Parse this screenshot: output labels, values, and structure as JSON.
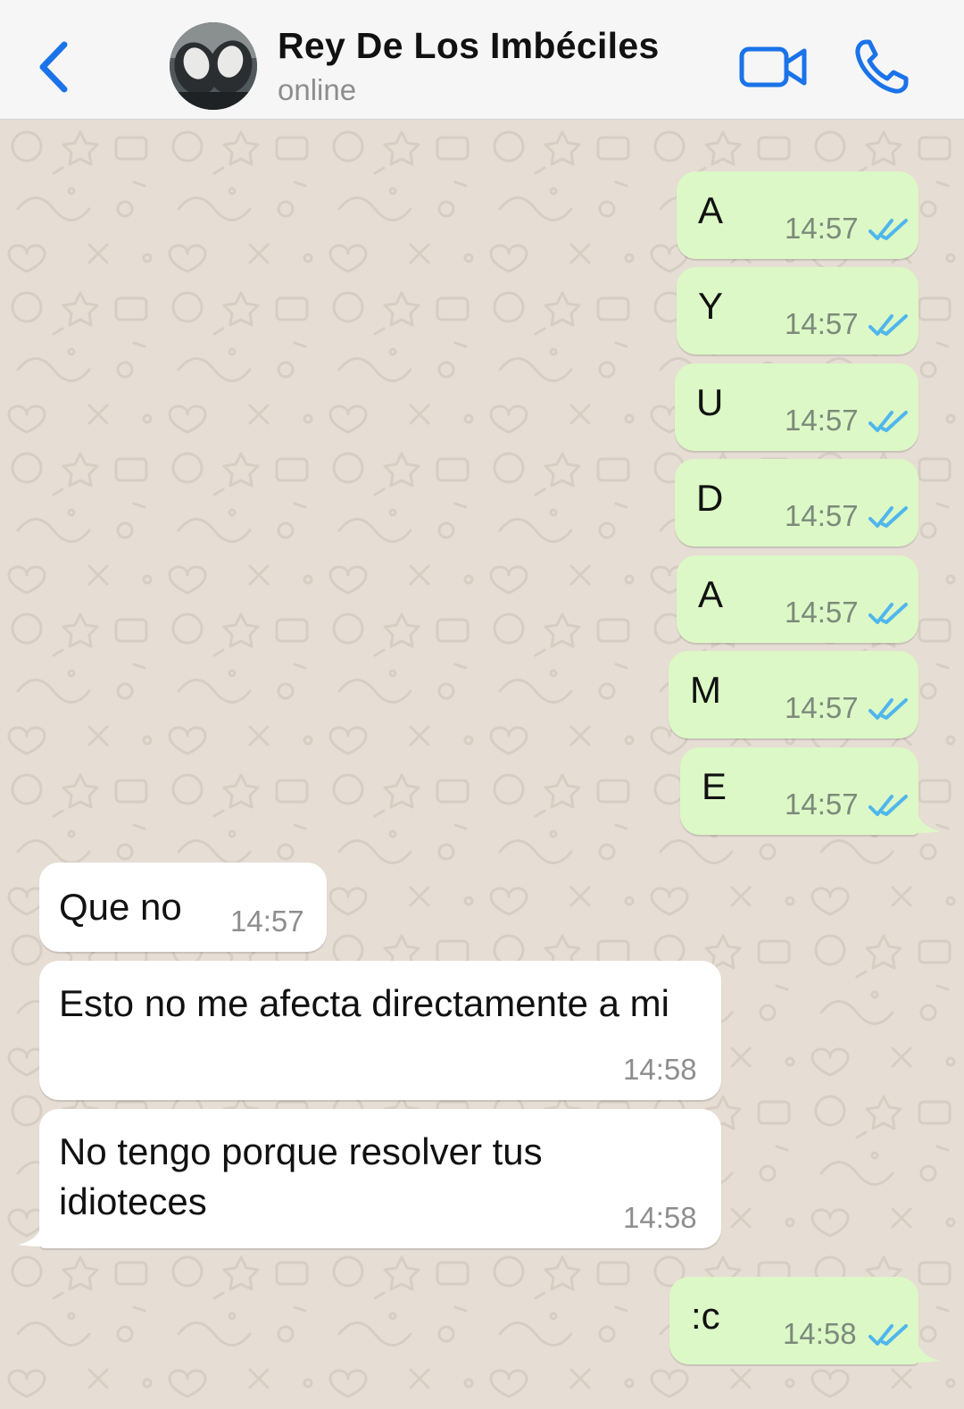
{
  "header": {
    "contact_name": "Rey De Los Imbéciles",
    "status": "online",
    "back_icon": "chevron-left-icon",
    "video_icon": "video-camera-icon",
    "call_icon": "phone-icon",
    "accent_color": "#1a73e8"
  },
  "messages": [
    {
      "direction": "out",
      "text": "A",
      "time": "14:57",
      "read": true
    },
    {
      "direction": "out",
      "text": "Y",
      "time": "14:57",
      "read": true
    },
    {
      "direction": "out",
      "text": "U",
      "time": "14:57",
      "read": true
    },
    {
      "direction": "out",
      "text": "D",
      "time": "14:57",
      "read": true
    },
    {
      "direction": "out",
      "text": "A",
      "time": "14:57",
      "read": true
    },
    {
      "direction": "out",
      "text": "M",
      "time": "14:57",
      "read": true
    },
    {
      "direction": "out",
      "text": "E",
      "time": "14:57",
      "read": true
    },
    {
      "direction": "in",
      "text": "Que no",
      "time": "14:57"
    },
    {
      "direction": "in",
      "text": "Esto no me afecta directamente a mi",
      "time": "14:58"
    },
    {
      "direction": "in",
      "text": "No tengo porque resolver tus idioteces",
      "time": "14:58"
    },
    {
      "direction": "out",
      "text": ":c",
      "time": "14:58",
      "read": true
    }
  ],
  "colors": {
    "outgoing_bubble": "#dcf8c6",
    "incoming_bubble": "#ffffff",
    "read_ticks": "#4fb6ec",
    "wallpaper": "#e6ddd4"
  }
}
